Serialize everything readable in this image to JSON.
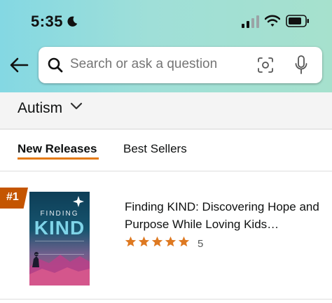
{
  "status_bar": {
    "time": "5:35"
  },
  "search": {
    "placeholder": "Search or ask a question"
  },
  "category": {
    "label": "Autism"
  },
  "tabs": [
    {
      "label": "New Releases",
      "active": true
    },
    {
      "label": "Best Sellers",
      "active": false
    }
  ],
  "product": {
    "rank": "#1",
    "cover_title_top": "FINDING",
    "cover_title_main": "KIND",
    "title": "Finding KIND: Discovering Hope and Purpose While Loving Kids…",
    "rating": 5,
    "review_count": "5"
  },
  "colors": {
    "accent": "#e47911",
    "rank_badge": "#c45500",
    "star": "#de7921",
    "header_gradient": [
      "#84d8e3",
      "#a6e1cd"
    ]
  },
  "icons": [
    "moon-icon",
    "cellular-signal-icon",
    "wifi-icon",
    "battery-icon",
    "back-arrow-icon",
    "search-icon",
    "camera-scan-icon",
    "microphone-icon",
    "chevron-down-icon",
    "star-icon"
  ]
}
